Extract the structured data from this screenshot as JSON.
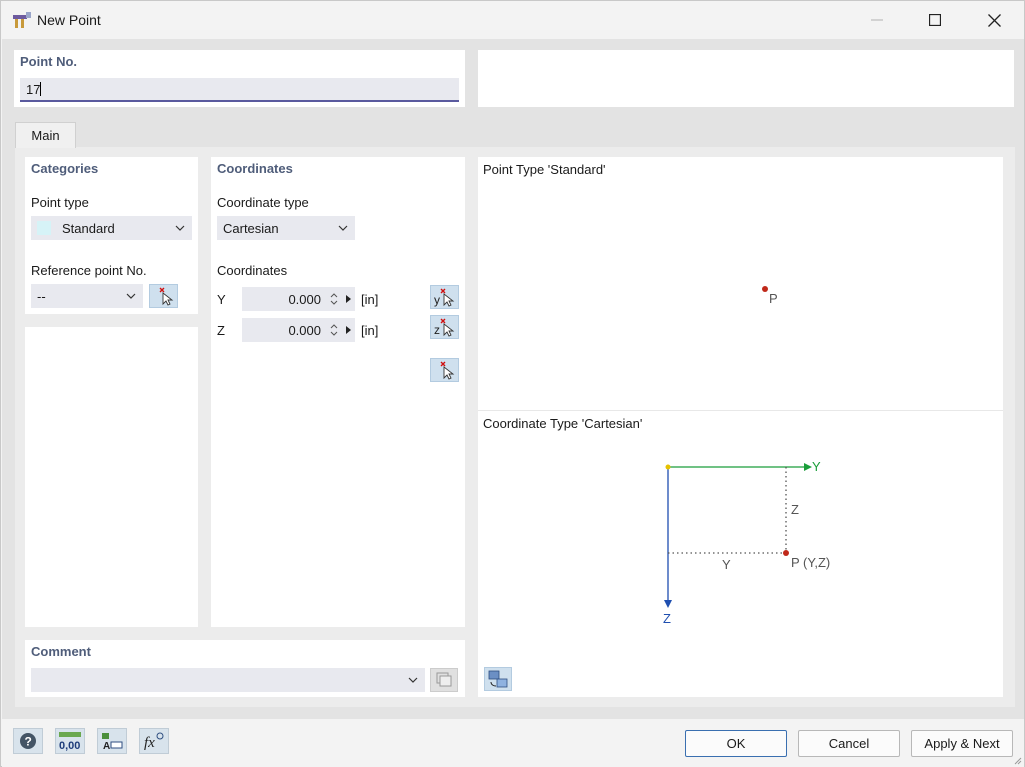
{
  "window": {
    "title": "New Point"
  },
  "point_no": {
    "label": "Point No.",
    "value": "17"
  },
  "tabs": [
    {
      "label": "Main"
    }
  ],
  "categories": {
    "heading": "Categories",
    "point_type_label": "Point type",
    "point_type_value": "Standard",
    "point_type_color": "#d6f3f7",
    "ref_label": "Reference point No.",
    "ref_value": "--"
  },
  "coordinates": {
    "heading": "Coordinates",
    "type_label": "Coordinate type",
    "type_value": "Cartesian",
    "coords_label": "Coordinates",
    "rows": [
      {
        "axis": "Y",
        "value": "0.000",
        "unit": "[in]",
        "pick_letter": "y"
      },
      {
        "axis": "Z",
        "value": "0.000",
        "unit": "[in]",
        "pick_letter": "z"
      }
    ]
  },
  "preview": {
    "point_type_title": "Point Type 'Standard'",
    "point_label": "P",
    "coord_type_title": "Coordinate Type 'Cartesian'",
    "axis_y": "Y",
    "axis_z": "Z",
    "dim_y": "Y",
    "dim_z": "Z",
    "point_coord_label": "P (Y,Z)",
    "colors": {
      "y_axis": "#1a9e3a",
      "z_axis": "#1f4fb0",
      "point": "#c0291a",
      "origin": "#e6c200"
    }
  },
  "comment": {
    "label": "Comment",
    "value": ""
  },
  "footer": {
    "ok": "OK",
    "cancel": "Cancel",
    "apply_next": "Apply & Next"
  }
}
